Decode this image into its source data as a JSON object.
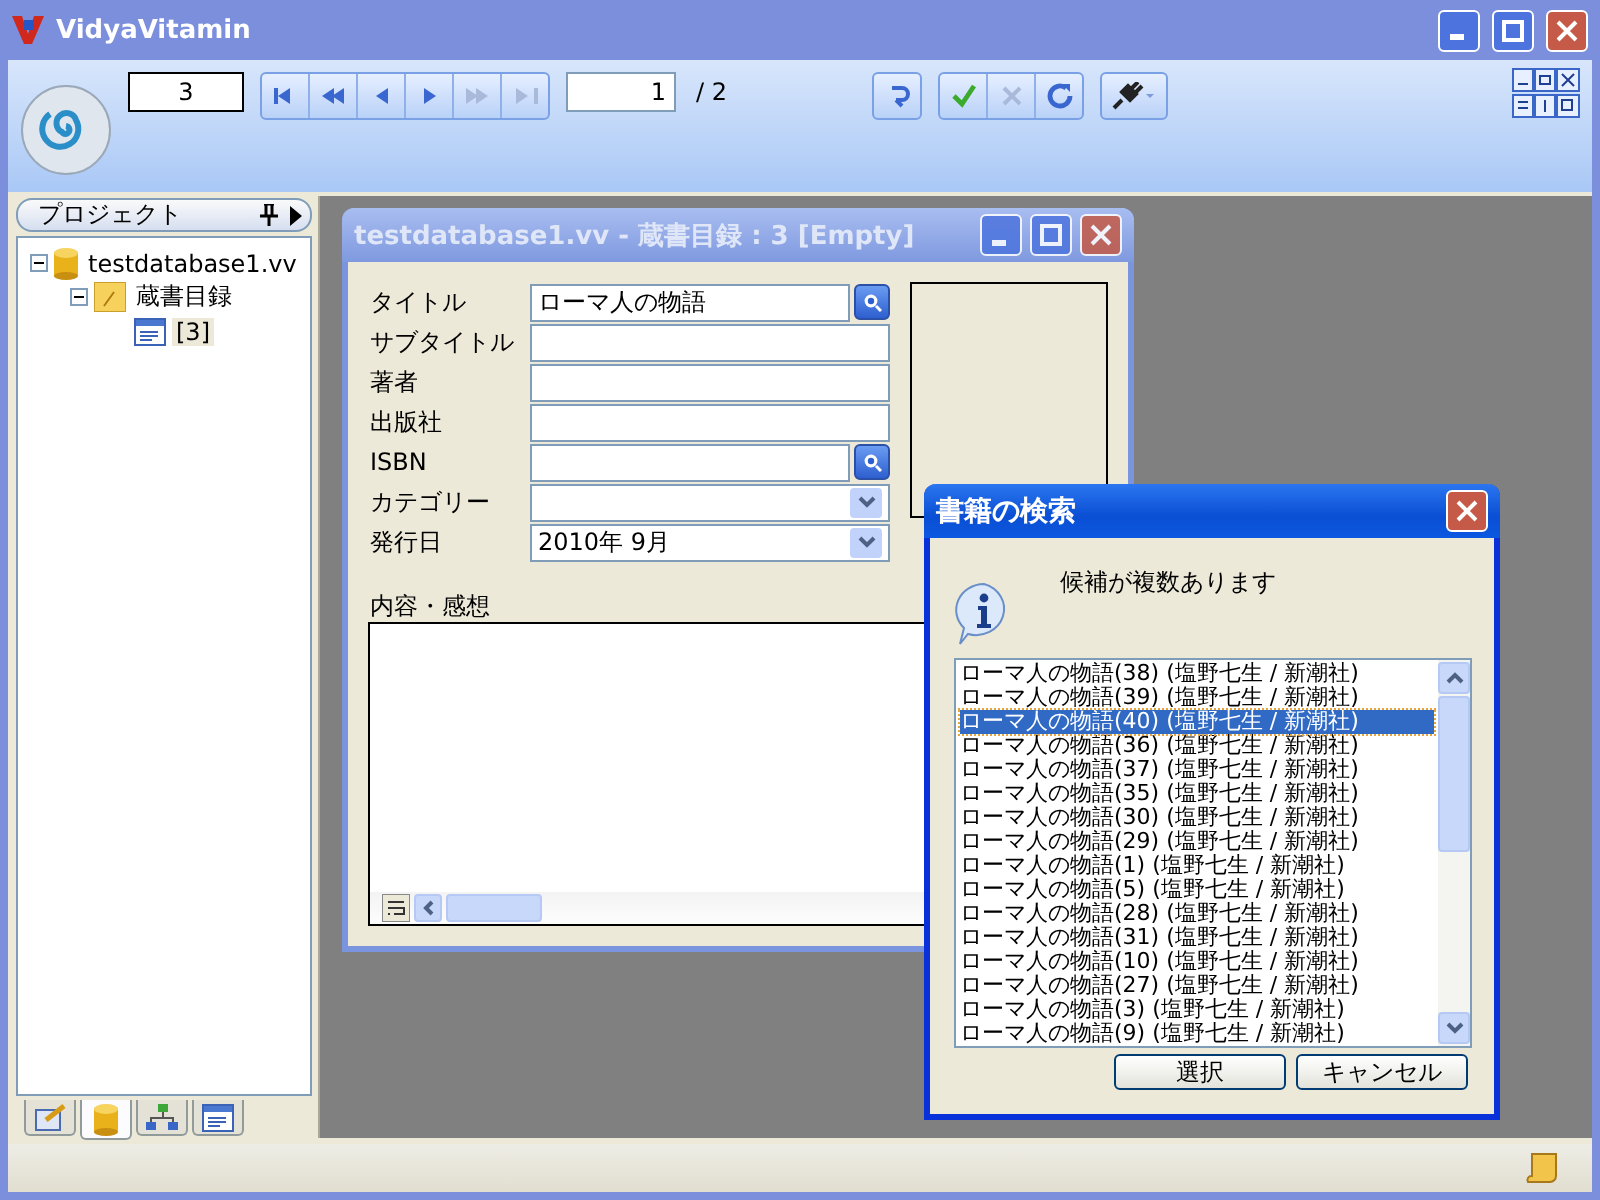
{
  "window": {
    "title": "VidyaVitamin"
  },
  "toolbar": {
    "record_field": "3",
    "page_field": "1",
    "page_total": "/ 2",
    "nav_buttons": [
      {
        "kind": "first",
        "disabled": false
      },
      {
        "kind": "rewind",
        "disabled": false
      },
      {
        "kind": "prev",
        "disabled": false
      },
      {
        "kind": "next",
        "disabled": false
      },
      {
        "kind": "forward",
        "disabled": true
      },
      {
        "kind": "last",
        "disabled": true
      }
    ],
    "edit_buttons": [
      {
        "kind": "undo",
        "disabled": false
      },
      {
        "kind": "confirm",
        "disabled": false
      },
      {
        "kind": "cancel",
        "disabled": true
      },
      {
        "kind": "refresh",
        "disabled": false
      }
    ]
  },
  "project_panel": {
    "title": "プロジェクト",
    "tree": [
      {
        "label": "testdatabase1.vv",
        "kind": "database",
        "expanded": true,
        "selected": false,
        "children": [
          {
            "label": "蔵書目録",
            "kind": "table",
            "expanded": true,
            "selected": false,
            "children": [
              {
                "label": "[3]",
                "kind": "form",
                "selected": true
              }
            ]
          }
        ]
      }
    ],
    "tabs": [
      {
        "kind": "properties",
        "selected": false
      },
      {
        "kind": "database",
        "selected": true
      },
      {
        "kind": "hierarchy",
        "selected": false
      },
      {
        "kind": "form",
        "selected": false
      }
    ]
  },
  "child_window": {
    "title": "testdatabase1.vv - 蔵書目録 : 3 [Empty]",
    "fields": [
      {
        "label": "タイトル",
        "value": "ローマ人の物語",
        "kind": "search"
      },
      {
        "label": "サブタイトル",
        "kind": "text"
      },
      {
        "label": "著者",
        "kind": "text"
      },
      {
        "label": "出版社",
        "kind": "text"
      },
      {
        "label": "ISBN",
        "kind": "search"
      },
      {
        "label": "カテゴリー",
        "kind": "dropdown"
      },
      {
        "label": "発行日",
        "value": "2010年  9月",
        "kind": "dropdown"
      }
    ],
    "memo_label": "内容・感想"
  },
  "dialog": {
    "title": "書籍の検索",
    "message": "候補が複数あります",
    "items": [
      {
        "label": "ローマ人の物語(38) (塩野七生 / 新潮社)",
        "selected": false
      },
      {
        "label": "ローマ人の物語(39) (塩野七生 / 新潮社)",
        "selected": false
      },
      {
        "label": "ローマ人の物語(40) (塩野七生 / 新潮社)",
        "selected": true
      },
      {
        "label": "ローマ人の物語(36) (塩野七生 / 新潮社)",
        "selected": false
      },
      {
        "label": "ローマ人の物語(37) (塩野七生 / 新潮社)",
        "selected": false
      },
      {
        "label": "ローマ人の物語(35) (塩野七生 / 新潮社)",
        "selected": false
      },
      {
        "label": "ローマ人の物語(30) (塩野七生 / 新潮社)",
        "selected": false
      },
      {
        "label": "ローマ人の物語(29) (塩野七生 / 新潮社)",
        "selected": false
      },
      {
        "label": "ローマ人の物語(1) (塩野七生 / 新潮社)",
        "selected": false
      },
      {
        "label": "ローマ人の物語(5) (塩野七生 / 新潮社)",
        "selected": false
      },
      {
        "label": "ローマ人の物語(28) (塩野七生 / 新潮社)",
        "selected": false
      },
      {
        "label": "ローマ人の物語(31) (塩野七生 / 新潮社)",
        "selected": false
      },
      {
        "label": "ローマ人の物語(10) (塩野七生 / 新潮社)",
        "selected": false
      },
      {
        "label": "ローマ人の物語(27) (塩野七生 / 新潮社)",
        "selected": false
      },
      {
        "label": "ローマ人の物語(3) (塩野七生 / 新潮社)",
        "selected": false
      },
      {
        "label": "ローマ人の物語(9) (塩野七生 / 新潮社)",
        "selected": false
      }
    ],
    "buttons": [
      "選択",
      "キャンセル"
    ]
  }
}
